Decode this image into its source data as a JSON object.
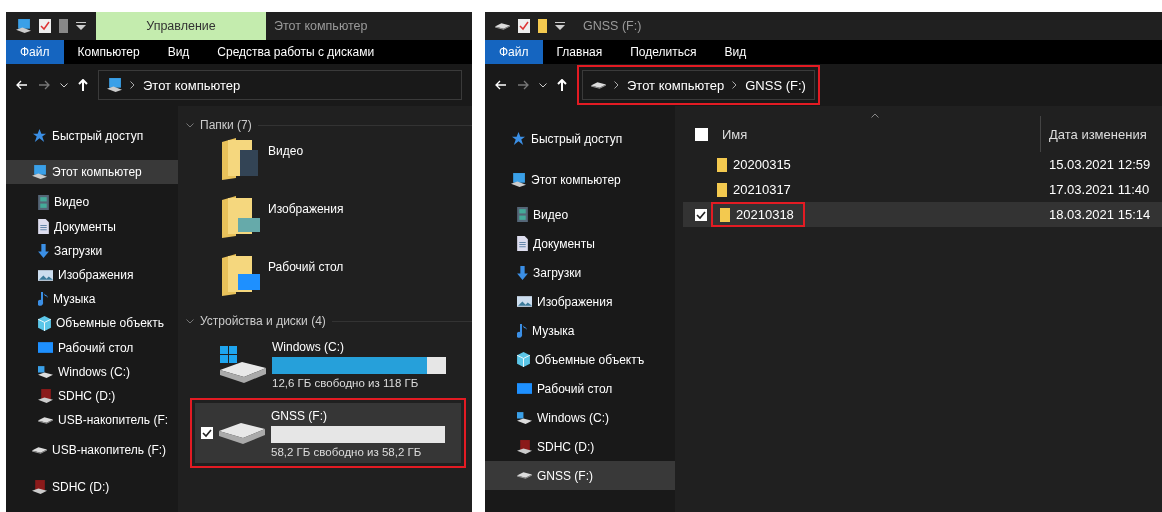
{
  "windows": [
    {
      "title_tabs": [
        {
          "label": "Управление",
          "kind": "context"
        },
        {
          "label": "Этот компьютер",
          "kind": "title"
        }
      ],
      "ribbon_tabs": [
        {
          "label": "Файл",
          "selected": true
        },
        {
          "label": "Компьютер",
          "selected": false
        },
        {
          "label": "Вид",
          "selected": false
        },
        {
          "label": "Средства работы с дисками",
          "selected": false
        }
      ],
      "address": {
        "kind": "pc",
        "annotated": false,
        "crumbs": [
          "Этот компьютер"
        ]
      },
      "sidebar": {
        "items": [
          {
            "label": "Быстрый доступ",
            "kind": "star",
            "selected": false
          },
          {
            "label": "Этот компьютер",
            "kind": "pc",
            "selected": true,
            "children": [
              {
                "label": "Видео",
                "kind": "video",
                "selected": false
              },
              {
                "label": "Документы",
                "kind": "docs",
                "selected": false
              },
              {
                "label": "Загрузки",
                "kind": "downloads",
                "selected": false
              },
              {
                "label": "Изображения",
                "kind": "pictures",
                "selected": false
              },
              {
                "label": "Музыка",
                "kind": "music",
                "selected": false
              },
              {
                "label": "Объемные объекть",
                "kind": "objects",
                "selected": false
              },
              {
                "label": "Рабочий стол",
                "kind": "desktop",
                "selected": false
              },
              {
                "label": "Windows (C:)",
                "kind": "system",
                "selected": false
              },
              {
                "label": "SDHC (D:)",
                "kind": "sd",
                "selected": false
              },
              {
                "label": "USB-накопитель (F:",
                "kind": "usb",
                "selected": false
              }
            ]
          },
          {
            "label": "USB-накопитель (F:)",
            "kind": "usb",
            "selected": false
          },
          {
            "label": "SDHC (D:)",
            "kind": "sd",
            "selected": false
          }
        ]
      },
      "content": {
        "kind": "pc",
        "groups": [
          {
            "heading": "Папки (7)",
            "kind": "folders",
            "items": [
              {
                "label": "Видео",
                "kind": "video"
              },
              {
                "label": "Изображения",
                "kind": "pictures"
              },
              {
                "label": "Рабочий стол",
                "kind": "desktop"
              }
            ]
          },
          {
            "heading": "Устройства и диски (4)",
            "kind": "drives",
            "items": [
              {
                "label": "Windows (C:)",
                "kind": "system",
                "level": 0.89,
                "free": "12,6 ГБ свободно из 118 ГБ",
                "selected": false,
                "checked": false,
                "annotated": false
              },
              {
                "label": "GNSS (F:)",
                "kind": "usb",
                "level": 0,
                "free": "58,2 ГБ свободно из 58,2 ГБ",
                "selected": true,
                "checked": true,
                "annotated": true
              }
            ]
          }
        ]
      }
    },
    {
      "title_tabs": [
        {
          "label": "GNSS (F:)",
          "kind": "title"
        }
      ],
      "ribbon_tabs": [
        {
          "label": "Файл",
          "selected": true
        },
        {
          "label": "Главная",
          "selected": false
        },
        {
          "label": "Поделиться",
          "selected": false
        },
        {
          "label": "Вид",
          "selected": false
        }
      ],
      "address": {
        "kind": "usb",
        "annotated": true,
        "crumbs": [
          "Этот компьютер",
          "GNSS (F:)"
        ]
      },
      "sidebar": {
        "items": [
          {
            "label": "Быстрый доступ",
            "kind": "star",
            "selected": false
          },
          {
            "label": "Этот компьютер",
            "kind": "pc",
            "selected": false,
            "children": [
              {
                "label": "Видео",
                "kind": "video",
                "selected": false
              },
              {
                "label": "Документы",
                "kind": "docs",
                "selected": false
              },
              {
                "label": "Загрузки",
                "kind": "downloads",
                "selected": false
              },
              {
                "label": "Изображения",
                "kind": "pictures",
                "selected": false
              },
              {
                "label": "Музыка",
                "kind": "music",
                "selected": false
              },
              {
                "label": "Объемные объектъ",
                "kind": "objects",
                "selected": false
              },
              {
                "label": "Рабочий стол",
                "kind": "desktop",
                "selected": false
              },
              {
                "label": "Windows (C:)",
                "kind": "system",
                "selected": false
              },
              {
                "label": "SDHC (D:)",
                "kind": "sd",
                "selected": false
              },
              {
                "label": "GNSS (F:)",
                "kind": "usb",
                "selected": true
              }
            ]
          }
        ]
      },
      "content": {
        "kind": "list",
        "columns": [
          {
            "label": "Имя"
          },
          {
            "label": "Дата изменения"
          }
        ],
        "header_checked": false,
        "rows": [
          {
            "name": "20200315",
            "date": "15.03.2021 12:59",
            "selected": false,
            "checked": false,
            "annotated": false
          },
          {
            "name": "20210317",
            "date": "17.03.2021 11:40",
            "selected": false,
            "checked": false,
            "annotated": false
          },
          {
            "name": "20210318",
            "date": "18.03.2021 15:14",
            "selected": true,
            "checked": true,
            "annotated": true
          }
        ]
      }
    }
  ]
}
